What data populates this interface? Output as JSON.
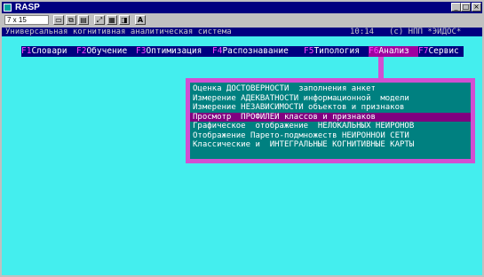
{
  "window": {
    "title": "RASP"
  },
  "window_controls": {
    "minimize": "_",
    "maximize": "□",
    "close": "×"
  },
  "toolbar": {
    "font_size": "7 x 15"
  },
  "status": {
    "left": "Универсальная когнитивная аналитическая система",
    "time": "10:14",
    "right": "(c) НПП *ЭЙДОС*"
  },
  "menu": [
    {
      "key": "F1",
      "label": "Словари"
    },
    {
      "key": "F2",
      "label": "Обучение"
    },
    {
      "key": "F3",
      "label": "Оптимизация"
    },
    {
      "key": "F4",
      "label": "Распознавание"
    },
    {
      "key": "F5",
      "label": "Типология"
    },
    {
      "key": "F6",
      "label": "Анализ"
    },
    {
      "key": "F7",
      "label": "Сервис"
    }
  ],
  "submenu": {
    "selected_index": 3,
    "items": [
      "Оценка ДОСТОВЕРНОСТИ  заполнения анкет",
      "Измерение АДЕКВАТНОСТИ информационной  модели",
      "Измерение НЕЗАВИСИМОСТИ объектов и признаков",
      "Просмотр  ПРОФИЛЕЙ классов и признаков",
      "Графическое  отображение  НЕЛОКАЛЬНЫХ НЕЙРОНОВ",
      "Отображение Парето-подмножеств НЕЙРОННОЙ СЕТИ",
      "Классические и  ИНТЕГРАЛЬНЫЕ КОГНИТИВНЫЕ КАРТЫ"
    ]
  }
}
